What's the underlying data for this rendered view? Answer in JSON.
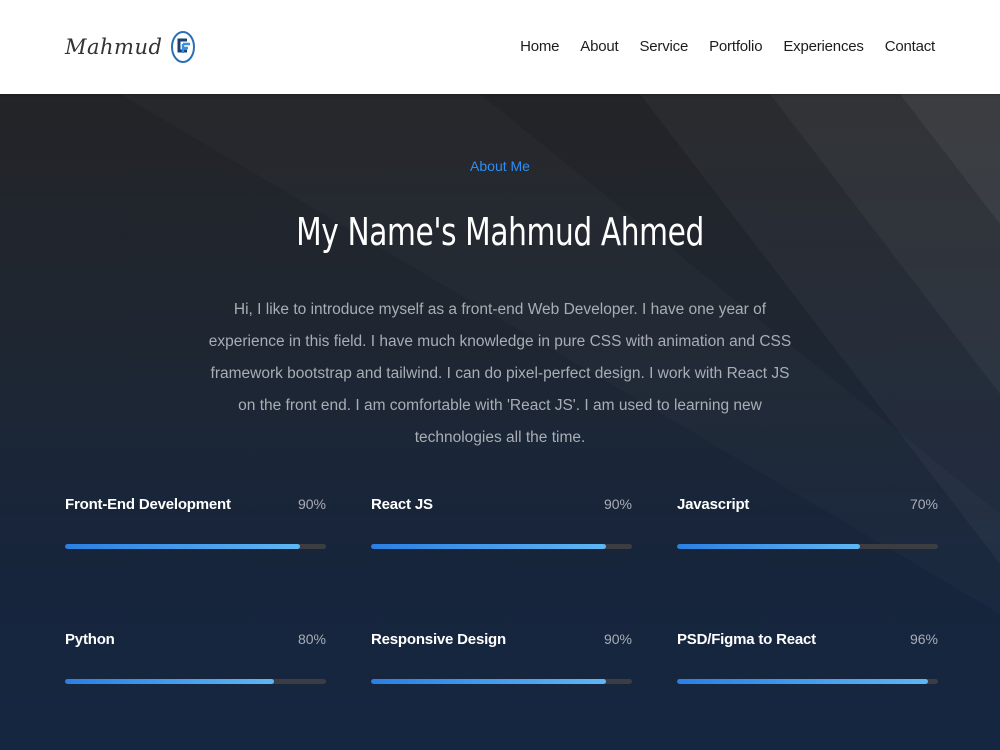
{
  "nav": {
    "logo_text": "Mahmud",
    "links": [
      "Home",
      "About",
      "Service",
      "Portfolio",
      "Experiences",
      "Contact"
    ]
  },
  "hero": {
    "eyebrow": "About Me",
    "title": "My Name's Mahmud Ahmed",
    "intro": "Hi, I like to introduce myself as a front-end Web Developer. I have one year of experience in this field. I have much knowledge in pure CSS with animation and CSS framework bootstrap and tailwind. I can do pixel-perfect design. I work with React JS on the front end. I am comfortable with 'React JS'. I am used to learning new technologies all the time."
  },
  "skills": [
    {
      "name": "Front-End Development",
      "percent_label": "90%",
      "level": 90
    },
    {
      "name": "React JS",
      "percent_label": "90%",
      "level": 90
    },
    {
      "name": "Javascript",
      "percent_label": "70%",
      "level": 70
    },
    {
      "name": "Python",
      "percent_label": "80%",
      "level": 80
    },
    {
      "name": "Responsive Design",
      "percent_label": "90%",
      "level": 90
    },
    {
      "name": "PSD/Figma to React",
      "percent_label": "96%",
      "level": 96
    }
  ],
  "colors": {
    "accent": "#2f8ef6",
    "bar_start": "#2b7fe3",
    "bar_end": "#5eb6f3",
    "track": "#3b3d42",
    "background": "#1a2637"
  },
  "icons": {
    "logo_mark": "cf-monogram-icon"
  }
}
